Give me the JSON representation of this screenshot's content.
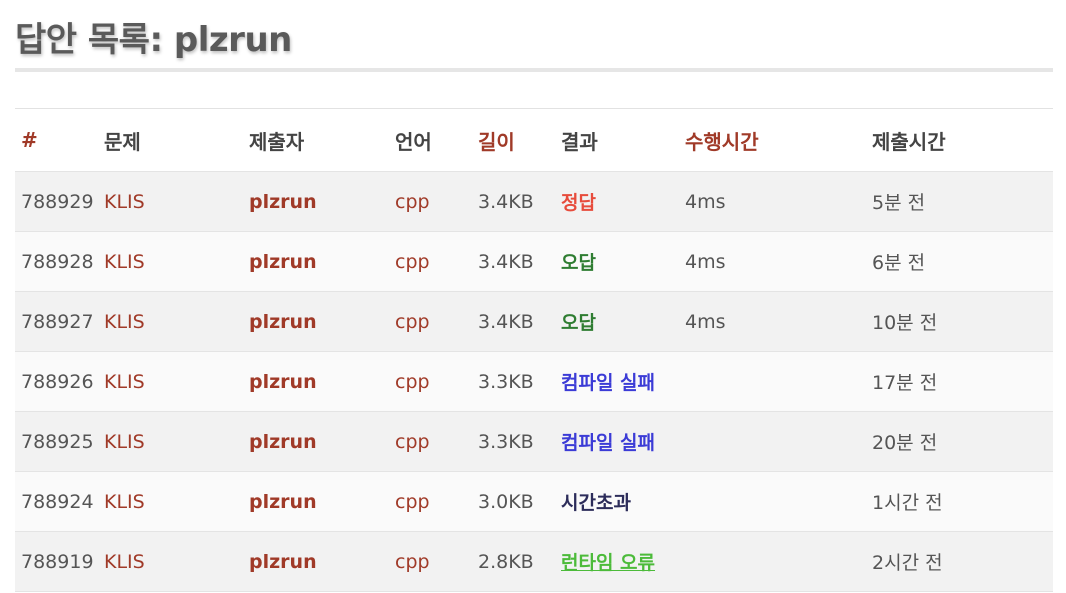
{
  "page": {
    "title": "답안 목록: plzrun"
  },
  "colors": {
    "accent_link": "#a03a28",
    "result_accepted": "#e74c3c",
    "result_wrong": "#2f7d32",
    "result_compile_error": "#3b3bd6",
    "result_time_limit": "#2c2c5a",
    "result_runtime_error": "#4cbb3a"
  },
  "table": {
    "headers": {
      "id": "#",
      "problem": "문제",
      "user": "제출자",
      "language": "언어",
      "length": "길이",
      "result": "결과",
      "time": "수행시간",
      "submitted": "제출시간"
    },
    "rows": [
      {
        "id": "788929",
        "problem": "KLIS",
        "user": "plzrun",
        "language": "cpp",
        "length": "3.4KB",
        "result": "정답",
        "result_type": "ac",
        "time": "4ms",
        "submitted": "5분 전"
      },
      {
        "id": "788928",
        "problem": "KLIS",
        "user": "plzrun",
        "language": "cpp",
        "length": "3.4KB",
        "result": "오답",
        "result_type": "wa",
        "time": "4ms",
        "submitted": "6분 전"
      },
      {
        "id": "788927",
        "problem": "KLIS",
        "user": "plzrun",
        "language": "cpp",
        "length": "3.4KB",
        "result": "오답",
        "result_type": "wa",
        "time": "4ms",
        "submitted": "10분 전"
      },
      {
        "id": "788926",
        "problem": "KLIS",
        "user": "plzrun",
        "language": "cpp",
        "length": "3.3KB",
        "result": "컴파일 실패",
        "result_type": "ce",
        "time": "",
        "submitted": "17분 전"
      },
      {
        "id": "788925",
        "problem": "KLIS",
        "user": "plzrun",
        "language": "cpp",
        "length": "3.3KB",
        "result": "컴파일 실패",
        "result_type": "ce",
        "time": "",
        "submitted": "20분 전"
      },
      {
        "id": "788924",
        "problem": "KLIS",
        "user": "plzrun",
        "language": "cpp",
        "length": "3.0KB",
        "result": "시간초과",
        "result_type": "tle",
        "time": "",
        "submitted": "1시간 전"
      },
      {
        "id": "788919",
        "problem": "KLIS",
        "user": "plzrun",
        "language": "cpp",
        "length": "2.8KB",
        "result": "런타임 오류",
        "result_type": "rte",
        "time": "",
        "submitted": "2시간 전"
      }
    ]
  }
}
